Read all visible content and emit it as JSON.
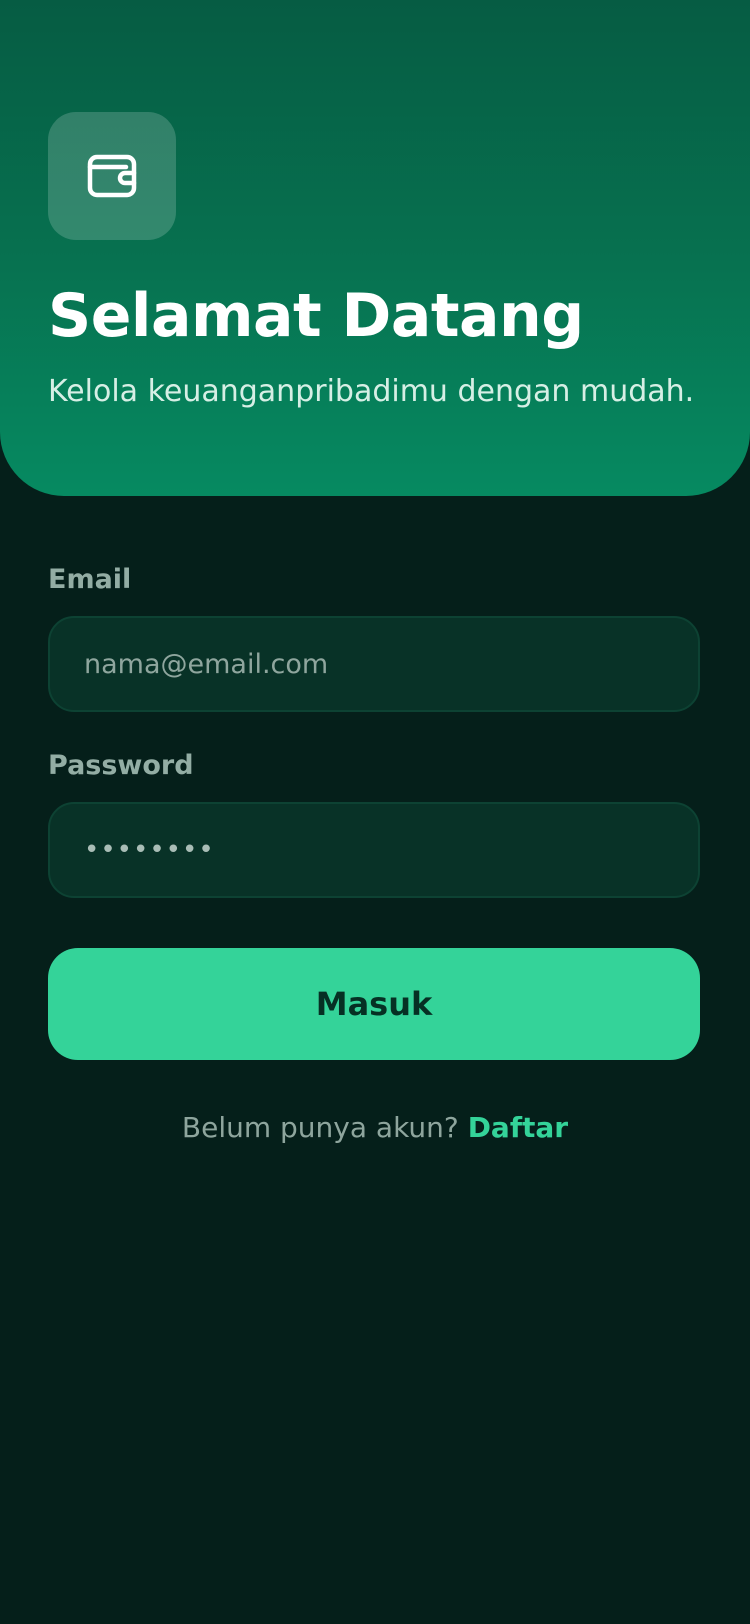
{
  "hero": {
    "title": "Selamat Datang",
    "subtitle": "Kelola keuanganpribadimu dengan mudah.",
    "logo_icon": "wallet-icon",
    "gradient_top": "#065c43",
    "gradient_bottom": "#068a61"
  },
  "form": {
    "email_label": "Email",
    "email_placeholder": "nama@email.com",
    "email_value": "",
    "password_label": "Password",
    "password_value": "••••••••",
    "submit_label": "Masuk"
  },
  "footer": {
    "prompt": "Belum punya akun? ",
    "link_label": "Daftar"
  },
  "colors": {
    "background": "#051f1a",
    "accent": "#34d399",
    "field_bg": "#083227"
  }
}
